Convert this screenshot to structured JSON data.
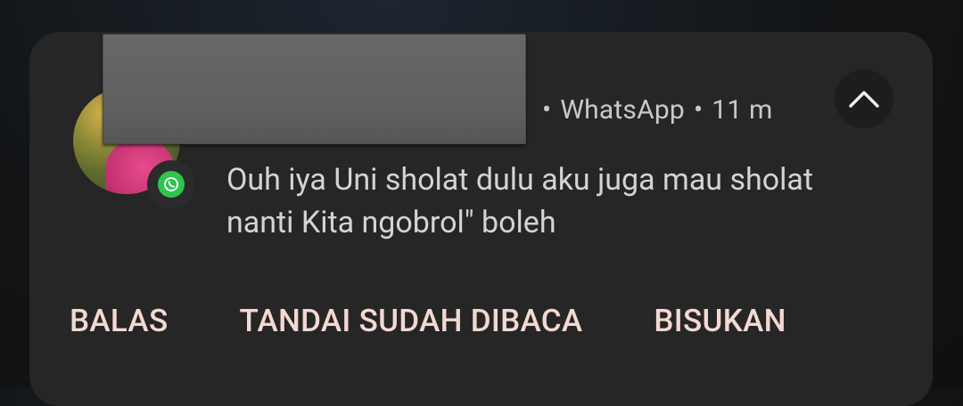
{
  "notification": {
    "app_name": "WhatsApp",
    "time": "11 m",
    "separator": "•",
    "message": "Ouh iya Uni sholat dulu aku juga mau sholat nanti Kita ngobrol\" boleh",
    "sender_redacted": true,
    "icons": {
      "app_badge": "whatsapp-icon",
      "expand": "chevron-up-icon",
      "avatar": "contact-avatar"
    },
    "colors": {
      "card_bg": "#262626",
      "action_text": "#f3d9d2",
      "whatsapp_green": "#2fc44e"
    }
  },
  "actions": {
    "reply": "BALAS",
    "mark_read": "TANDAI SUDAH DIBACA",
    "mute": "BISUKAN"
  }
}
